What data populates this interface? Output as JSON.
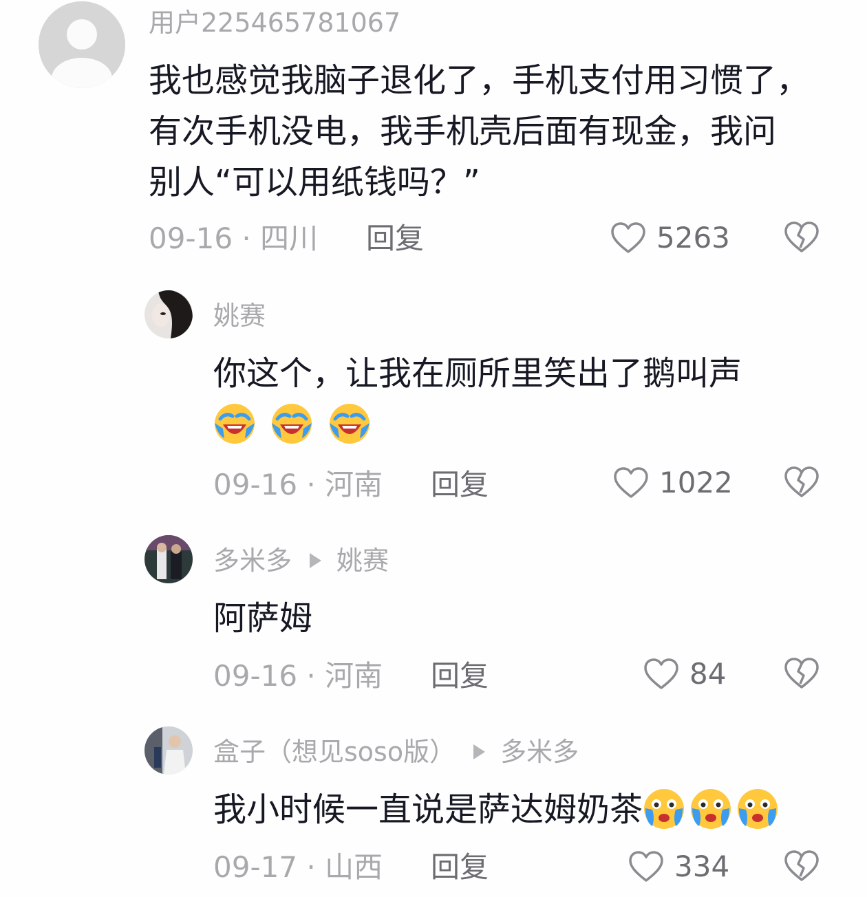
{
  "comments": [
    {
      "username": "用户225465781067",
      "text_lines": [
        "我也感觉我脑子退化了，手机支付用习惯了，",
        "有次手机没电，我手机壳后面有现金，我问",
        "别人“可以用纸钱吗？”"
      ],
      "date_location": "09-16 · 四川",
      "reply_label": "回复",
      "like_count": "5263"
    },
    {
      "username": "姚赛",
      "text": "你这个，让我在厕所里笑出了鹅叫声",
      "emojis": [
        "loudly-crying-laugh",
        "loudly-crying-laugh",
        "loudly-crying-laugh"
      ],
      "date_location": "09-16 · 河南",
      "reply_label": "回复",
      "like_count": "1022"
    },
    {
      "username": "多米多",
      "reply_to": "姚赛",
      "text": "阿萨姆",
      "date_location": "09-16 · 河南",
      "reply_label": "回复",
      "like_count": "84"
    },
    {
      "username": "盒子（想见soso版）",
      "reply_to": "多米多",
      "text": "我小时候一直说是萨达姆奶茶",
      "emojis": [
        "crying-face",
        "crying-face",
        "crying-face"
      ],
      "date_location": "09-17 · 山西",
      "reply_label": "回复",
      "like_count": "334"
    }
  ],
  "icons": {
    "like": "heart-outline-icon",
    "dislike": "broken-heart-icon",
    "reply_arrow": "play-triangle-icon"
  },
  "colors": {
    "primary_text": "#161823",
    "secondary_text": "#a9a9ad",
    "action_text": "#6c6c72",
    "emoji_yellow": "#ffc83d",
    "tear_blue": "#3b9cf0"
  }
}
